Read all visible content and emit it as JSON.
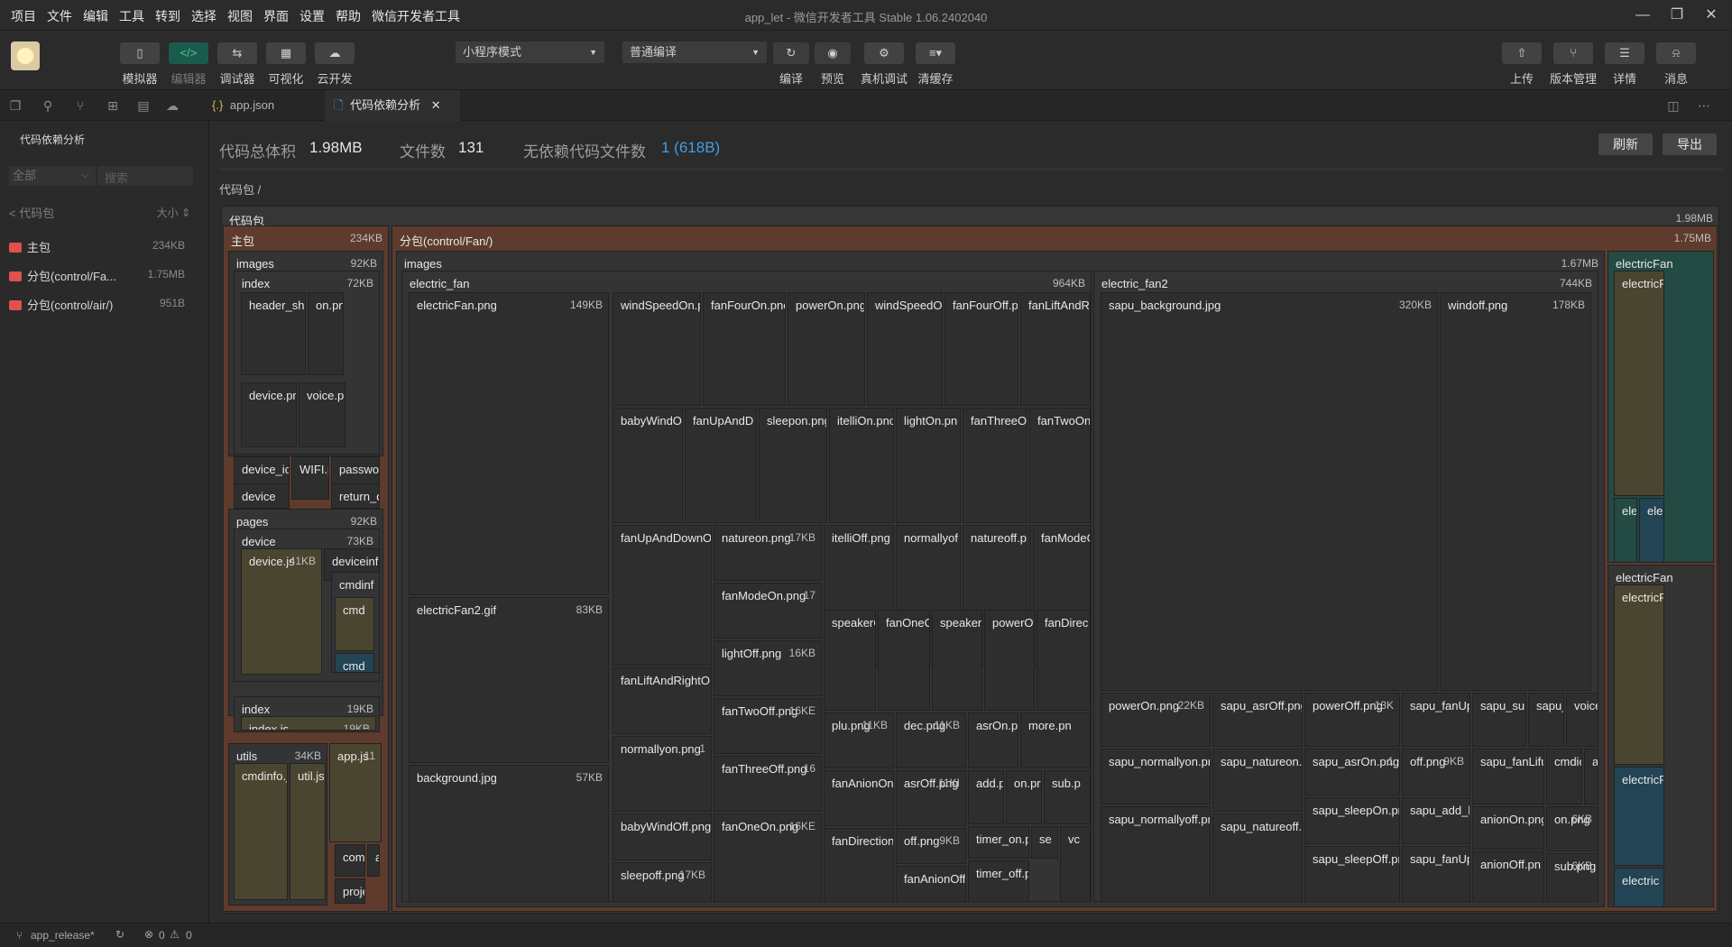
{
  "menubar": {
    "items": [
      "项目",
      "文件",
      "编辑",
      "工具",
      "转到",
      "选择",
      "视图",
      "界面",
      "设置",
      "帮助",
      "微信开发者工具"
    ],
    "title": "app_let - 微信开发者工具 Stable 1.06.2402040"
  },
  "toolbar": {
    "left_buttons": [
      {
        "label": "模拟器",
        "icon": "phone-icon",
        "active": false
      },
      {
        "label": "编辑器",
        "icon": "code-icon",
        "active": true
      },
      {
        "label": "调试器",
        "icon": "debug-icon",
        "active": false
      },
      {
        "label": "可视化",
        "icon": "layout-icon",
        "active": false
      },
      {
        "label": "云开发",
        "icon": "cloud-icon",
        "active": false
      }
    ],
    "mode_dropdown": "小程序模式",
    "compile_dropdown": "普通编译",
    "mid_buttons": [
      {
        "label": "编译",
        "icon": "refresh-icon"
      },
      {
        "label": "预览",
        "icon": "eye-icon"
      },
      {
        "label": "真机调试",
        "icon": "bug-icon"
      },
      {
        "label": "清缓存",
        "icon": "layers-icon"
      }
    ],
    "right_buttons": [
      {
        "label": "上传",
        "icon": "upload-icon"
      },
      {
        "label": "版本管理",
        "icon": "branch-icon"
      },
      {
        "label": "详情",
        "icon": "menu-icon"
      },
      {
        "label": "消息",
        "icon": "bell-icon"
      }
    ]
  },
  "tabs": [
    {
      "label": "app.json",
      "icon": "{.}",
      "active": false
    },
    {
      "label": "代码依赖分析",
      "icon": "file-icon",
      "active": true
    }
  ],
  "sidebar": {
    "title": "代码依赖分析",
    "filter": "全部",
    "search_placeholder": "搜索",
    "col_name": "< 代码包",
    "col_size": "大小 ⇕",
    "packages": [
      {
        "name": "主包",
        "size": "234KB"
      },
      {
        "name": "分包(control/Fa...",
        "size": "1.75MB"
      },
      {
        "name": "分包(control/air/)",
        "size": "951B"
      }
    ]
  },
  "summary": {
    "total_label": "代码总体积",
    "total_value": "1.98MB",
    "files_label": "文件数",
    "files_value": "131",
    "nodep_label": "无依赖代码文件数",
    "nodep_value": "1 (618B)",
    "refresh": "刷新",
    "export": "导出",
    "breadcrumb": "代码包 /"
  },
  "treemap": {
    "root": {
      "name": "代码包",
      "size": "1.98MB"
    },
    "main": {
      "name": "主包",
      "size": "234KB"
    },
    "sub": {
      "name": "分包(control/Fan/)",
      "size": "1.75MB"
    },
    "nodes": [
      {
        "n": "images",
        "s": "92KB"
      },
      {
        "n": "index",
        "s": "72KB"
      },
      {
        "n": "header_shape2.",
        "s": ""
      },
      {
        "n": "on.png",
        "s": ""
      },
      {
        "n": "device.png",
        "s": ""
      },
      {
        "n": "voice.png",
        "s": ""
      },
      {
        "n": "device_ic",
        "s": ""
      },
      {
        "n": "WIFI.p",
        "s": ""
      },
      {
        "n": "passwor",
        "s": ""
      },
      {
        "n": "device",
        "s": ""
      },
      {
        "n": "return_d",
        "s": ""
      },
      {
        "n": "pages",
        "s": "92KB"
      },
      {
        "n": "device",
        "s": "73KB"
      },
      {
        "n": "device.js",
        "s": "41KB"
      },
      {
        "n": "deviceinf",
        "s": ""
      },
      {
        "n": "cmdinf",
        "s": ""
      },
      {
        "n": "cmd",
        "s": ""
      },
      {
        "n": "cmd",
        "s": ""
      },
      {
        "n": "index",
        "s": "19KB"
      },
      {
        "n": "index.js",
        "s": "19KB"
      },
      {
        "n": "utils",
        "s": "34KB"
      },
      {
        "n": "cmdinfo.j",
        "s": ""
      },
      {
        "n": "util.js",
        "s": ""
      },
      {
        "n": "app.js",
        "s": "11"
      },
      {
        "n": "comp",
        "s": ""
      },
      {
        "n": "a",
        "s": ""
      },
      {
        "n": "proje",
        "s": ""
      },
      {
        "n": "images",
        "s": "1.67MB"
      },
      {
        "n": "electric_fan",
        "s": "964KB"
      },
      {
        "n": "electricFan.png",
        "s": "149KB"
      },
      {
        "n": "electricFan2.gif",
        "s": "83KB"
      },
      {
        "n": "background.jpg",
        "s": "57KB"
      },
      {
        "n": "windSpeedOn.p",
        "s": ""
      },
      {
        "n": "fanFourOn.pnc",
        "s": ""
      },
      {
        "n": "powerOn.png",
        "s": ""
      },
      {
        "n": "windSpeedO",
        "s": ""
      },
      {
        "n": "fanFourOff.p",
        "s": ""
      },
      {
        "n": "fanLiftAndRi",
        "s": ""
      },
      {
        "n": "babyWindO",
        "s": ""
      },
      {
        "n": "fanUpAndD",
        "s": ""
      },
      {
        "n": "sleepon.png",
        "s": ""
      },
      {
        "n": "itelliOn.pnc",
        "s": ""
      },
      {
        "n": "lightOn.pn",
        "s": ""
      },
      {
        "n": "fanThreeO",
        "s": ""
      },
      {
        "n": "fanTwoOn.",
        "s": ""
      },
      {
        "n": "fanUpAndDownO",
        "s": ""
      },
      {
        "n": "natureon.png",
        "s": "17KB"
      },
      {
        "n": "itelliOff.png",
        "s": ""
      },
      {
        "n": "normallyof",
        "s": ""
      },
      {
        "n": "natureoff.p",
        "s": ""
      },
      {
        "n": "fanModeC",
        "s": ""
      },
      {
        "n": "fanLiftAndRightO",
        "s": ""
      },
      {
        "n": "fanModeOn.png",
        "s": "17"
      },
      {
        "n": "speakerC",
        "s": ""
      },
      {
        "n": "fanOneC",
        "s": ""
      },
      {
        "n": "speakerC",
        "s": ""
      },
      {
        "n": "powerOf",
        "s": ""
      },
      {
        "n": "fanDirec",
        "s": ""
      },
      {
        "n": "normallyon.png",
        "s": "1"
      },
      {
        "n": "lightOff.png",
        "s": "16KB"
      },
      {
        "n": "fanTwoOff.png",
        "s": "16KE"
      },
      {
        "n": "plu.png",
        "s": "11KB"
      },
      {
        "n": "dec.png",
        "s": "11KB"
      },
      {
        "n": "asrOn.pn",
        "s": ""
      },
      {
        "n": "more.pn",
        "s": ""
      },
      {
        "n": "babyWindOff.png",
        "s": ""
      },
      {
        "n": "fanThreeOff.png",
        "s": "16"
      },
      {
        "n": "fanAnionOn.",
        "s": ""
      },
      {
        "n": "asrOff.png",
        "s": "11KI"
      },
      {
        "n": "add.p",
        "s": ""
      },
      {
        "n": "on.pr",
        "s": ""
      },
      {
        "n": "sub.p",
        "s": ""
      },
      {
        "n": "sleepoff.png",
        "s": "17KB"
      },
      {
        "n": "fanOneOn.png",
        "s": "16KE"
      },
      {
        "n": "fanDirection",
        "s": ""
      },
      {
        "n": "off.png",
        "s": "9KB"
      },
      {
        "n": "fanAnionOff.pr",
        "s": ""
      },
      {
        "n": "timer_on.pr",
        "s": ""
      },
      {
        "n": "se",
        "s": ""
      },
      {
        "n": "vc",
        "s": ""
      },
      {
        "n": "timer_off.pr",
        "s": ""
      },
      {
        "n": "electric_fan2",
        "s": "744KB"
      },
      {
        "n": "sapu_background.jpg",
        "s": "320KB"
      },
      {
        "n": "windoff.png",
        "s": "178KB"
      },
      {
        "n": "powerOn.png",
        "s": "22KB"
      },
      {
        "n": "sapu_asrOff.png",
        "s": ""
      },
      {
        "n": "powerOff.png",
        "s": "13K"
      },
      {
        "n": "sapu_fanUp",
        "s": ""
      },
      {
        "n": "sapu_su",
        "s": ""
      },
      {
        "n": "sapu_fai",
        "s": ""
      },
      {
        "n": "voice.pr",
        "s": ""
      },
      {
        "n": "sapu_normallyon.pr",
        "s": ""
      },
      {
        "n": "sapu_natureon.p",
        "s": ""
      },
      {
        "n": "sapu_asrOn.png",
        "s": "1"
      },
      {
        "n": "off.png",
        "s": "9KB"
      },
      {
        "n": "sapu_fanLifu",
        "s": ""
      },
      {
        "n": "cmdicc",
        "s": ""
      },
      {
        "n": "add.p",
        "s": ""
      },
      {
        "n": "sapu_sleepOn.pn",
        "s": ""
      },
      {
        "n": "sapu_add_b",
        "s": ""
      },
      {
        "n": "anionOn.png",
        "s": ""
      },
      {
        "n": "sapu_normallyoff.pr",
        "s": ""
      },
      {
        "n": "sapu_natureoff.p",
        "s": ""
      },
      {
        "n": "sapu_sleepOff.pn",
        "s": ""
      },
      {
        "n": "sapu_fanUp",
        "s": ""
      },
      {
        "n": "anionOff.pn",
        "s": ""
      },
      {
        "n": "on.png",
        "s": "6KB"
      },
      {
        "n": "sub.png",
        "s": "6KB"
      },
      {
        "n": "electricFan",
        "s": ""
      },
      {
        "n": "electricF",
        "s": ""
      },
      {
        "n": "elec",
        "s": ""
      },
      {
        "n": "ele",
        "s": ""
      },
      {
        "n": "electricFan",
        "s": ""
      },
      {
        "n": "electricF",
        "s": ""
      },
      {
        "n": "electricF",
        "s": ""
      },
      {
        "n": "electric",
        "s": ""
      }
    ]
  },
  "statusbar": {
    "branch": "app_release*",
    "errors": "0",
    "warnings": "0"
  }
}
